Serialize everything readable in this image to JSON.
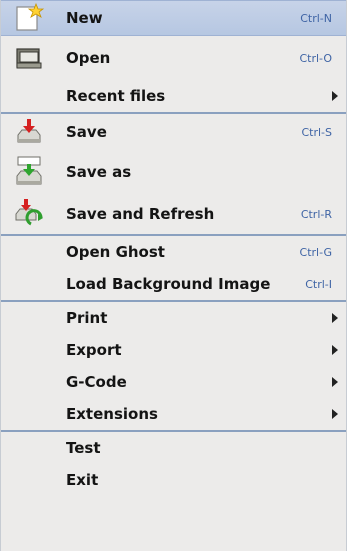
{
  "menu": {
    "items": [
      {
        "label": "New",
        "shortcut": "Ctrl-N",
        "icon": "new-file-icon"
      },
      {
        "label": "Open",
        "shortcut": "Ctrl-O",
        "icon": "folder-open-icon"
      },
      {
        "label": "Recent files",
        "shortcut": "",
        "icon": ""
      },
      {
        "label": "Save",
        "shortcut": "Ctrl-S",
        "icon": "save-icon"
      },
      {
        "label": "Save as",
        "shortcut": "",
        "icon": "save-as-icon"
      },
      {
        "label": "Save and Refresh",
        "shortcut": "Ctrl-R",
        "icon": "save-refresh-icon"
      },
      {
        "label": "Open Ghost",
        "shortcut": "Ctrl-G",
        "icon": ""
      },
      {
        "label": "Load Background Image",
        "shortcut": "Ctrl-I",
        "icon": ""
      },
      {
        "label": "Print",
        "shortcut": "",
        "icon": ""
      },
      {
        "label": "Export",
        "shortcut": "",
        "icon": ""
      },
      {
        "label": "G-Code",
        "shortcut": "",
        "icon": ""
      },
      {
        "label": "Extensions",
        "shortcut": "",
        "icon": ""
      },
      {
        "label": "Test",
        "shortcut": "",
        "icon": ""
      },
      {
        "label": "Exit",
        "shortcut": "",
        "icon": ""
      }
    ]
  },
  "colors": {
    "selected_background": "#bccbe4",
    "shortcut_text": "#3f64a5",
    "separator": "#8aa0bf"
  }
}
